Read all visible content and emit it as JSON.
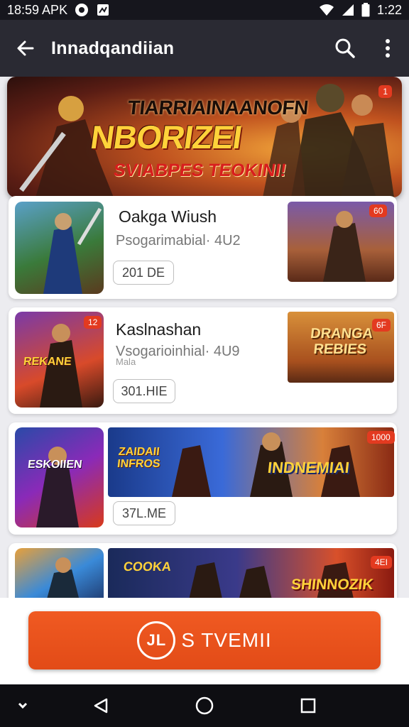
{
  "status_bar": {
    "time_left": "18:59 APK",
    "time_right": "1:22"
  },
  "app_bar": {
    "title": "Innadqandiian",
    "back_icon": "arrow-left-icon",
    "search_icon": "search-icon",
    "menu_icon": "more-vert-icon"
  },
  "banner": {
    "line1": "TIARRIAINAANOFN",
    "line2": "NBORIZEI",
    "line3": "SVIABPES TEOKINI!",
    "badge": "1"
  },
  "cards": [
    {
      "name": "Oakga Wiush",
      "subtitle": "Psogarimabial· 4U2",
      "button": "201 DE",
      "left_badge": "",
      "right_art_text": "",
      "right_badge": "60"
    },
    {
      "name": "Kaslnashan",
      "subtitle": "Vsogarioinhial· 4U9",
      "subtitle_extra": "Mala",
      "button": "301.HIE",
      "left_badge": "12",
      "left_art_text": "REKANE",
      "right_art_text": "DRANGA REBIES",
      "right_badge": "6F"
    },
    {
      "name": "",
      "subtitle": "",
      "button": "37L.ME",
      "left_art_text": "ESKOIIEN",
      "wide_art_text1": "ZAIDAII INFROS",
      "wide_art_text2": "INDNEMIAI",
      "right_badge": "1000"
    },
    {
      "name": "",
      "subtitle": "",
      "button": "",
      "wide_art_text1": "COOKA",
      "wide_art_text2": "SHINNOZIK",
      "right_badge": "4EI"
    }
  ],
  "cta": {
    "logo_text": "JL",
    "label": "S TVEMII"
  },
  "colors": {
    "accent": "#e24b17",
    "appbar": "#2a2a33",
    "statusbar": "#16161d"
  }
}
